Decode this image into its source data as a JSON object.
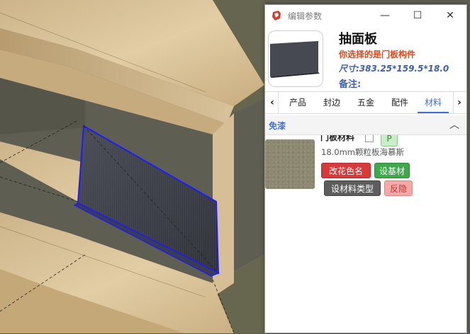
{
  "window": {
    "title": "编辑参数",
    "controls": {
      "minimize": "—",
      "maximize": "☐",
      "close": "✕"
    }
  },
  "part": {
    "name": "抽面板",
    "selection_note": "你选择的是门板构件",
    "size": "尺寸:383.25*159.5*18.0",
    "remark_label": "备注:"
  },
  "tabs": {
    "prev": "‹",
    "next": "›",
    "items": [
      {
        "label": "产品",
        "active": false
      },
      {
        "label": "封边",
        "active": false
      },
      {
        "label": "五金",
        "active": false
      },
      {
        "label": "配件",
        "active": false
      },
      {
        "label": "材料",
        "active": true
      }
    ]
  },
  "section": {
    "title": "免漆",
    "collapse_icon": "chevron-up-icon"
  },
  "material": {
    "name": "门板材料",
    "badge": "P",
    "description": "18.0mm颗粒板海慕斯",
    "buttons": {
      "rename": "改花色名",
      "set_base": "设基材",
      "set_type": "设材料类型",
      "hidden": "反隐"
    }
  },
  "colors": {
    "accent_blue": "#3f6fd1",
    "note_orange": "#e2461b",
    "red_button": "#d73a3a",
    "green_button": "#3ea84b",
    "gray_button": "#5d5d5d",
    "pink_button": "#f4a9a9"
  }
}
